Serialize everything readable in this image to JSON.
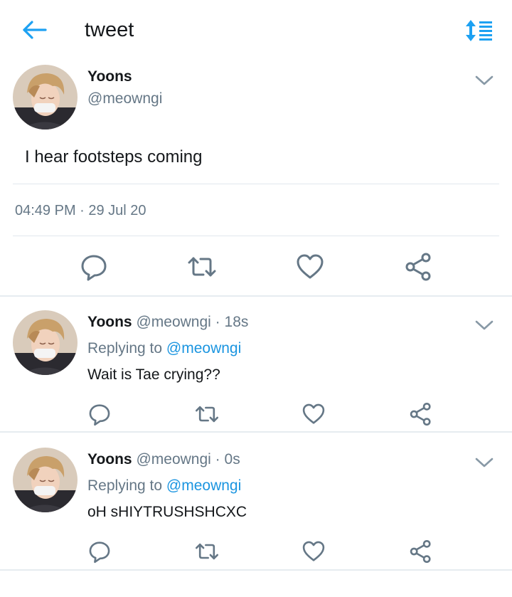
{
  "header": {
    "title": "tweet",
    "back_icon": "back-arrow-icon",
    "sort_icon": "sort-icon",
    "accent": "#1da1f2"
  },
  "main_tweet": {
    "name": "Yoons",
    "handle": "@meowngi",
    "text": "I hear footsteps coming",
    "timestamp": "04:49 PM · 29 Jul 20",
    "actions": [
      "reply-icon",
      "retweet-icon",
      "like-icon",
      "share-icon"
    ]
  },
  "replies": [
    {
      "name": "Yoons",
      "handle": "@meowngi",
      "separator": "·",
      "time": "18s",
      "replying_prefix": "Replying to ",
      "replying_to": "@meowngi",
      "text": "Wait is Tae crying??"
    },
    {
      "name": "Yoons",
      "handle": "@meowngi",
      "separator": "·",
      "time": "0s",
      "replying_prefix": "Replying to ",
      "replying_to": "@meowngi",
      "text": "oH sHIYTRUSHSHCXC"
    }
  ],
  "colors": {
    "text": "#14171a",
    "secondary": "#657786",
    "link": "#1b95e0",
    "icon": "#657786",
    "divider": "#e1e8ed"
  }
}
